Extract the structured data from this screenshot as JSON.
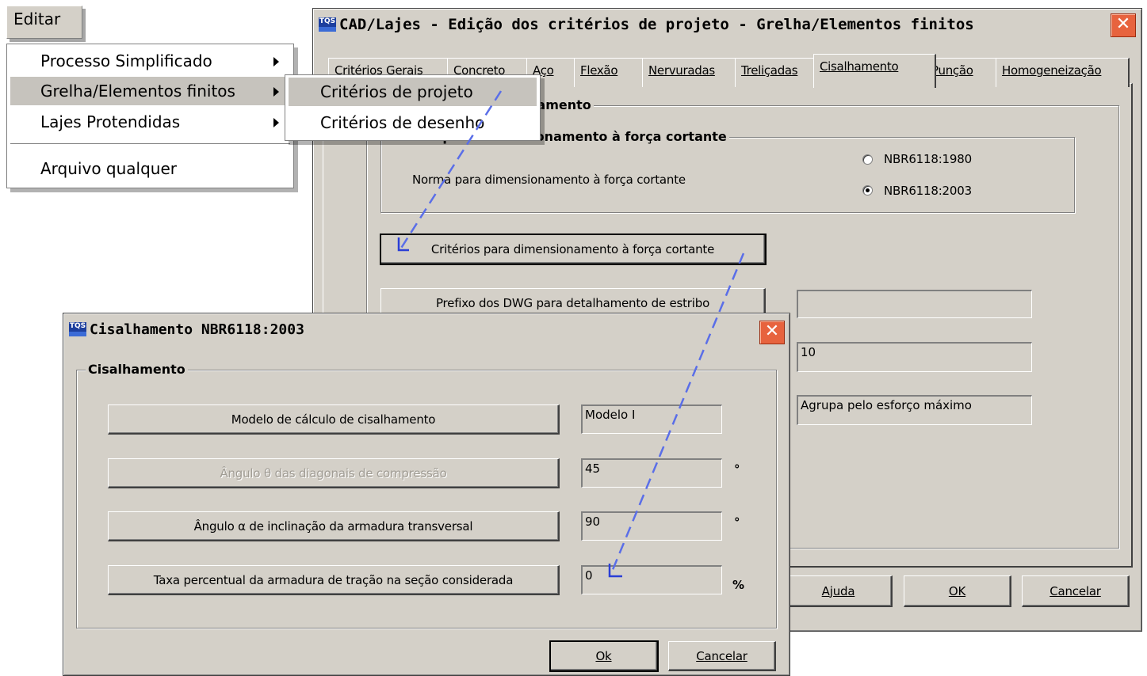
{
  "main_dialog": {
    "title": "CAD/Lajes - Edição dos critérios de projeto - Grelha/Elementos finitos",
    "tabs": [
      "Critérios Gerais",
      "Concreto",
      "Aço",
      "Flexão",
      "Nervuradas",
      "Treliçadas",
      "Cisalhamento",
      "Punção",
      "Homogeneização"
    ],
    "active_tab": "Cisalhamento",
    "group_title": "Cisalhamento",
    "subgroup_title": "Norma para dimensionamento à força cortante",
    "norm_label": "Norma para dimensionamento à força cortante",
    "radio_1980": "NBR6118:1980",
    "radio_2003": "NBR6118:2003",
    "criteria_button": "Critérios para dimensionamento à força cortante",
    "prefix_button": "Prefixo dos DWG para detalhamento de estribo",
    "prefix_value": "",
    "field_2": "10",
    "field_3": "Agrupa pelo esforço máximo",
    "help_button": "Ajuda",
    "ok_button": "OK",
    "cancel_button": "Cancelar"
  },
  "menu": {
    "title": "Editar",
    "items": [
      "Processo Simplificado",
      "Grelha/Elementos finitos",
      "Lajes Protendidas",
      "Arquivo qualquer"
    ],
    "submenu": [
      "Critérios de projeto",
      "Critérios de desenho"
    ]
  },
  "sub_dialog": {
    "title": "Cisalhamento NBR6118:2003",
    "group_title": "Cisalhamento",
    "rows": [
      {
        "button": "Modelo de cálculo de cisalhamento",
        "value": "Modelo I",
        "unit": ""
      },
      {
        "button": "Ângulo θ das diagonais de compressão",
        "value": "45",
        "unit": "°"
      },
      {
        "button": "Ângulo α de inclinação da armadura transversal",
        "value": "90",
        "unit": "°"
      },
      {
        "button": "Taxa percentual da armadura de tração na seção considerada",
        "value": "0",
        "unit": "%"
      }
    ],
    "ok_button": "Ok",
    "cancel_button": "Cancelar"
  },
  "logo_text": "TQS",
  "colors": {
    "dialog_bg": "#d4d0c8",
    "close_button": "#e7633e",
    "connector": "#5a6ee8"
  }
}
